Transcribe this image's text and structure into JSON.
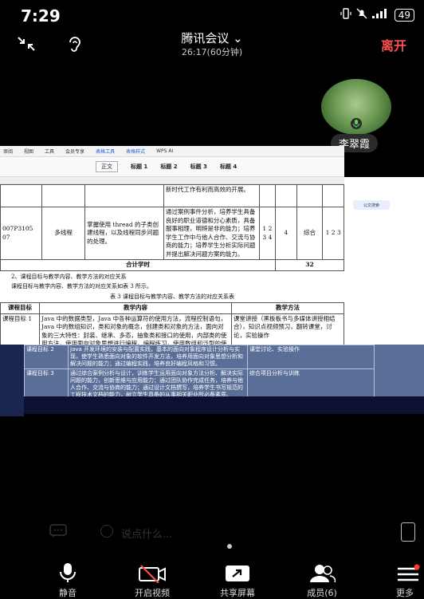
{
  "status": {
    "time": "7:29",
    "battery": "49"
  },
  "header": {
    "title": "腾讯会议",
    "duration": "26:17(60分钟)",
    "leave": "离开"
  },
  "participant": {
    "name": "李翠霞"
  },
  "doc": {
    "tabs": [
      "审阅",
      "视图",
      "工具",
      "会员专享",
      "表格工具",
      "表格样式",
      "WPS AI"
    ],
    "styles": [
      "正文",
      "标题 1",
      "标题 2",
      "标题 3",
      "标题 4"
    ],
    "ai_chip": "公文搜索",
    "row1_content": "新时代工作有利而高效的开展。",
    "row1_method": "通过案例事件分析，培养学生具备良好的职业道德和分心素质，具备服事相理，明辨是非的能力；培养学生工作中与他人合作、交流与协商的能力；培养学生分析实际问题并提出解决问题方案的能力。",
    "row2_code": "007P3105 07",
    "row2_topic": "多线程",
    "row2_desc": "掌握使用 thread 的子类创建线程，以及线程同步问题的处理。",
    "row2_nums": "1 2 3 4",
    "row2_hours": "4",
    "row2_type": "综合",
    "row2_nums2": "1 2 3",
    "total_label": "合计学时",
    "total_value": "32",
    "section": "2、课程目标与教学内容、教学方法的对应关系",
    "section_intro": "课程目标与教学内容、教学方法的对应关系如表 3 所示。",
    "caption": "表 3  课程目标与教学内容、教学方法的对应关系表",
    "headers": [
      "课程目标",
      "教学内容",
      "教学方法"
    ],
    "goal1": "课程目标 1",
    "goal1_content": "Java 中的数据类型，Java 中各种运算符的使用方法，流程控制语句，Java 中的数组知识，类和对象的概念，创建类和对象的方法，面向对象的三大特性：封装、继承、多态，抽象类和接口的使用，内部类的使用方法，使用面向对象思想进行编程，编程练习，使用数组和泛型的使用，输入输出，10",
    "goal1_method": "课堂讲授（黑板板书与多媒体讲授相结合），知识点视频预习，翻转课堂，讨论，实验操作",
    "goal2": "课程目标 2",
    "goal2_content": "Java 开发环境的安装与配置实践，基本的面向对象程序设计分析与实现，使学生熟悉面向对象的软件开发方法，培养用面向对象思想分析和解决问题的能力；通过编程实践，培养良好编程风格和习惯。",
    "goal2_method": "课堂讨论、实验操作",
    "goal3": "课程目标 3",
    "goal3_content": "通过综合案例分析与设计，训练学生运用面向对象方法分析、解决实际问题的能力，创新思维与应用能力；通过团队协作完成任务，培养与他人合作、交流与协商的能力；通过设计文档撰写，培养学生书写规范的工程技术文档的能力，树立学生具备的从事相关职业所必备素质。",
    "goal3_method": "综合项目分析与训练"
  },
  "chat": {
    "placeholder": "说点什么..."
  },
  "toolbar": [
    {
      "label": "静音",
      "icon": "microphone-icon"
    },
    {
      "label": "开启视频",
      "icon": "video-off-icon"
    },
    {
      "label": "共享屏幕",
      "icon": "share-screen-icon"
    },
    {
      "label": "成员(6)",
      "icon": "members-icon"
    },
    {
      "label": "更多",
      "icon": "more-icon"
    }
  ]
}
